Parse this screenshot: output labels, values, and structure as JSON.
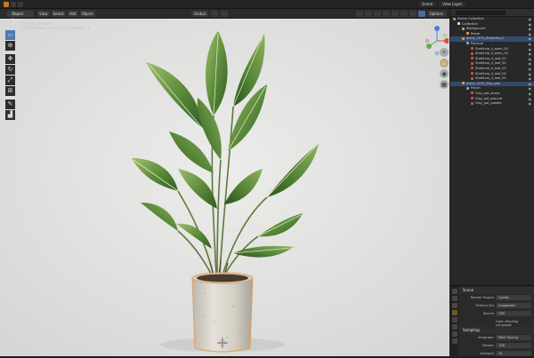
{
  "topbar": {
    "scene_label": "Scene",
    "view_layer_label": "View Layer"
  },
  "viewport": {
    "mode": "Object Mode",
    "menus": [
      "View",
      "Select",
      "Add",
      "Object"
    ],
    "pivot_label": "Global",
    "options_label": "Options",
    "info_line1": "User Perspective",
    "info_line2": "(1) Collection | plant_1370_Strelitzia_4",
    "tools": [
      "select-box",
      "cursor",
      "move",
      "rotate",
      "scale",
      "transform",
      "annotate",
      "measure"
    ]
  },
  "outliner": {
    "rows": [
      {
        "label": "Scene Collection",
        "depth": 0,
        "icon_color": "#9a9a9a",
        "selected": false
      },
      {
        "label": "Collection",
        "depth": 1,
        "icon_color": "#e8e8e8",
        "selected": false
      },
      {
        "label": "Background",
        "depth": 2,
        "icon_color": "#d8a040",
        "selected": false
      },
      {
        "label": "Room",
        "depth": 3,
        "icon_color": "#e69a3a",
        "selected": false
      },
      {
        "label": "plant_1370_Strelitzia_4",
        "depth": 2,
        "icon_color": "#e69a3a",
        "selected": true
      },
      {
        "label": "Pavonia",
        "depth": 3,
        "icon_color": "#7eaad8",
        "selected": false
      },
      {
        "label": "Strelitzia_4_stem_01",
        "depth": 4,
        "icon_color": "#d05050",
        "selected": false
      },
      {
        "label": "Strelitzia_4_stem_02",
        "depth": 4,
        "icon_color": "#d05050",
        "selected": false
      },
      {
        "label": "Strelitzia_4_leaf_01",
        "depth": 4,
        "icon_color": "#d05050",
        "selected": false
      },
      {
        "label": "Strelitzia_4_leaf_02",
        "depth": 4,
        "icon_color": "#d05050",
        "selected": false
      },
      {
        "label": "Strelitzia_4_leaf_03",
        "depth": 4,
        "icon_color": "#d05050",
        "selected": false
      },
      {
        "label": "Strelitzia_4_leaf_04",
        "depth": 4,
        "icon_color": "#d05050",
        "selected": false
      },
      {
        "label": "Strelitzia_4_leaf_05",
        "depth": 4,
        "icon_color": "#d05050",
        "selected": false
      },
      {
        "label": "plant_1370_Clay_pot",
        "depth": 2,
        "icon_color": "#e69a3a",
        "selected": true
      },
      {
        "label": "Pavon",
        "depth": 3,
        "icon_color": "#7eaad8",
        "selected": false
      },
      {
        "label": "Clay_pot_stone",
        "depth": 4,
        "icon_color": "#d05050",
        "selected": false
      },
      {
        "label": "Clay_pot_ground",
        "depth": 4,
        "icon_color": "#d05050",
        "selected": false
      },
      {
        "label": "Clay_pot_pebble",
        "depth": 4,
        "icon_color": "#d05050",
        "selected": false
      }
    ]
  },
  "properties": {
    "title": "Scene",
    "render_engine_label": "Render Engine",
    "render_engine_value": "Cycles",
    "feature_set_label": "Feature Set",
    "feature_set_value": "Supported",
    "device_label": "Device",
    "device_value": "CPU",
    "osl_label": "Open Shading Language",
    "sampling_section": "Sampling",
    "integrator_label": "Integrator",
    "integrator_value": "Path Tracing",
    "render_label": "Render",
    "render_value": "128",
    "viewport_label": "Viewport",
    "viewport_value": "32"
  },
  "colors": {
    "accent": "#4f78b4",
    "selection": "#334a6e",
    "viewport_bg": "#e4e4e2"
  }
}
